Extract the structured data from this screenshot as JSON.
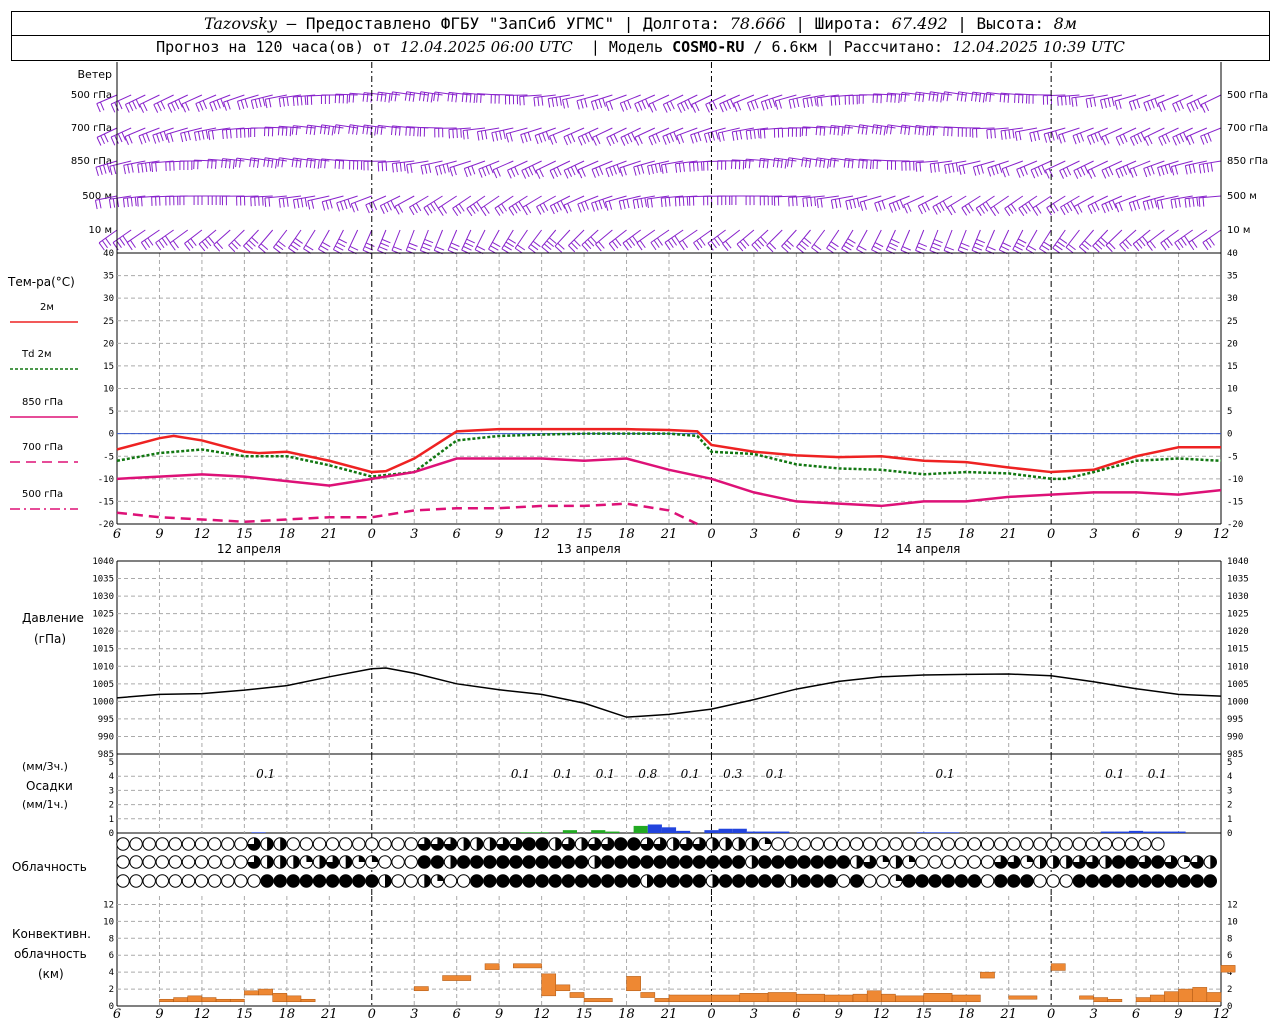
{
  "header": {
    "station": "Tazovsky",
    "provided": " — Предоставлено ФГБУ \"ЗапСиб УГМС\" | Долгота: ",
    "lon": "78.666",
    "lat_label": " | Широта: ",
    "lat": "67.492",
    "alt_label": " | Высота: ",
    "alt": "8м",
    "forecast_label": "Прогноз на 120 часа(ов) от ",
    "forecast_time": "12.04.2025 06:00 UTC",
    "model_label": "  | Модель ",
    "model": "COSMO-RU",
    "model_res": " / 6.6км",
    "calc_label": " | Рассчитано: ",
    "calc_time": "12.04.2025 10:39 UTC"
  },
  "panels": {
    "wind": {
      "title": "Ветер",
      "levels": [
        "500 гПа",
        "700 гПа",
        "850 гПа",
        "500 м",
        "10  м"
      ]
    },
    "temp": {
      "title": "Тем-ра(°С)",
      "legend": [
        {
          "label": "2м",
          "color": "#ee2222",
          "dash": ""
        },
        {
          "label": "Td  2м",
          "color": "#117711",
          "dash": "3,2"
        },
        {
          "label": "850 гПа",
          "color": "#dd1177",
          "dash": ""
        },
        {
          "label": "700 гПа",
          "color": "#dd1177",
          "dash": "10,6"
        },
        {
          "label": "500 гПа",
          "color": "#dd1177",
          "dash": "10,4,2,4"
        }
      ]
    },
    "pressure": {
      "title1": "Давление",
      "title2": "(гПа)"
    },
    "precip": {
      "title1": "(мм/3ч.)",
      "title2": "Осадки",
      "title3": "(мм/1ч.)"
    },
    "cloud": {
      "title": "Облачность"
    },
    "conv": {
      "title1": "Конвективн.",
      "title2": "облачность",
      "title3": "(км)"
    }
  },
  "time_axis": {
    "hour_labels": [
      "6",
      "9",
      "12",
      "15",
      "18",
      "21",
      "0",
      "3",
      "6",
      "9",
      "12",
      "15",
      "18",
      "21",
      "0",
      "3",
      "6",
      "9",
      "12",
      "15",
      "18",
      "21",
      "0",
      "3",
      "6",
      "9",
      "12"
    ],
    "day_labels": [
      {
        "label": "12 апреля",
        "at_hour": 6
      },
      {
        "label": "13 апреля",
        "at_hour": 30
      },
      {
        "label": "14 апреля",
        "at_hour": 54
      }
    ]
  },
  "chart_data": [
    {
      "type": "line",
      "title": "Тем-ра(°С)",
      "x_unit": "hours from 12.04 00 UTC",
      "ylim": [
        -20,
        40
      ],
      "yticks": [
        -20,
        -15,
        -10,
        -5,
        0,
        5,
        10,
        15,
        20,
        25,
        30,
        35,
        40
      ],
      "series": [
        {
          "name": "2м",
          "x": [
            6,
            9,
            10,
            12,
            15,
            16,
            18,
            21,
            24,
            25,
            27,
            30,
            33,
            36,
            39,
            42,
            45,
            47,
            48,
            51,
            54,
            57,
            60,
            63,
            66,
            69,
            72,
            75,
            78,
            81,
            84
          ],
          "values": [
            -3.5,
            -1,
            -0.5,
            -1.5,
            -4,
            -4.3,
            -4,
            -6,
            -8.5,
            -8.3,
            -5.5,
            0.5,
            1,
            1,
            1,
            1,
            0.8,
            0.5,
            -2.5,
            -4,
            -4.8,
            -5.2,
            -5,
            -6,
            -6.3,
            -7.5,
            -8.5,
            -8,
            -5,
            -3,
            -3
          ]
        },
        {
          "name": "Td  2м",
          "x": [
            6,
            9,
            12,
            15,
            18,
            21,
            24,
            27,
            30,
            33,
            36,
            39,
            42,
            45,
            47,
            48,
            51,
            54,
            57,
            60,
            63,
            66,
            69,
            72,
            73,
            75,
            78,
            81,
            84
          ],
          "values": [
            -6,
            -4.3,
            -3.5,
            -5,
            -5,
            -7,
            -9.5,
            -8.5,
            -1.5,
            -0.5,
            -0.2,
            0,
            0,
            0,
            -0.5,
            -4,
            -4.5,
            -6.8,
            -7.7,
            -8,
            -9,
            -8.5,
            -8.8,
            -10,
            -10,
            -8.5,
            -6,
            -5.5,
            -6
          ]
        },
        {
          "name": "850 гПа",
          "x": [
            6,
            9,
            12,
            15,
            18,
            21,
            24,
            27,
            30,
            33,
            36,
            39,
            42,
            45,
            48,
            51,
            54,
            57,
            60,
            63,
            66,
            69,
            72,
            75,
            78,
            81,
            84
          ],
          "values": [
            -10,
            -9.5,
            -9,
            -9.5,
            -10.5,
            -11.5,
            -10,
            -8.5,
            -5.5,
            -5.5,
            -5.5,
            -6,
            -5.5,
            -8,
            -10,
            -13,
            -15,
            -15.5,
            -16,
            -15,
            -15,
            -14,
            -13.5,
            -13,
            -13,
            -13.5,
            -12.5
          ]
        },
        {
          "name": "700 гПа",
          "x": [
            6,
            9,
            12,
            15,
            18,
            21,
            24,
            27,
            30,
            33,
            36,
            39,
            42,
            45,
            47
          ],
          "values": [
            -17.5,
            -18.5,
            -19,
            -19.5,
            -19,
            -18.5,
            -18.5,
            -17,
            -16.5,
            -16.5,
            -16,
            -16,
            -15.5,
            -17,
            -20
          ]
        },
        {
          "name": "500 гПа",
          "x": [],
          "values": []
        }
      ]
    },
    {
      "type": "line",
      "title": "Давление",
      "ylim": [
        985,
        1040
      ],
      "yticks": [
        985,
        990,
        995,
        1000,
        1005,
        1010,
        1015,
        1020,
        1025,
        1030,
        1035,
        1040
      ],
      "series": [
        {
          "name": "Давление",
          "x": [
            6,
            9,
            12,
            15,
            18,
            21,
            24,
            25,
            27,
            30,
            33,
            36,
            39,
            42,
            45,
            48,
            51,
            54,
            57,
            60,
            63,
            66,
            69,
            72,
            75,
            78,
            81,
            84
          ],
          "values": [
            1001,
            1002,
            1002.2,
            1003.2,
            1004.5,
            1007,
            1009.3,
            1009.5,
            1008,
            1005,
            1003.3,
            1002,
            999.5,
            995.5,
            996.3,
            997.8,
            1000.5,
            1003.5,
            1005.7,
            1007,
            1007.5,
            1007.7,
            1007.8,
            1007.3,
            1005.6,
            1003.6,
            1002,
            1001.5
          ]
        }
      ]
    },
    {
      "type": "bar",
      "title": "Осадки",
      "ylim": [
        0,
        5
      ],
      "yticks": [
        0,
        1,
        2,
        3,
        4,
        5
      ],
      "labels_3h": [
        {
          "x": 16.5,
          "text": "0.1"
        },
        {
          "x": 34.5,
          "text": "0.1"
        },
        {
          "x": 37.5,
          "text": "0.1"
        },
        {
          "x": 40.5,
          "text": "0.1"
        },
        {
          "x": 43.5,
          "text": "0.8"
        },
        {
          "x": 46.5,
          "text": "0.1"
        },
        {
          "x": 49.5,
          "text": "0.3"
        },
        {
          "x": 52.5,
          "text": "0.1"
        },
        {
          "x": 64.5,
          "text": "0.1"
        },
        {
          "x": 76.5,
          "text": "0.1"
        },
        {
          "x": 79.5,
          "text": "0.1"
        }
      ],
      "bars_1h": [
        {
          "x": 16,
          "value": 0.05,
          "color": "#2244dd"
        },
        {
          "x": 35,
          "value": 0.05,
          "color": "#22aa22"
        },
        {
          "x": 36,
          "value": 0.05,
          "color": "#22aa22"
        },
        {
          "x": 38,
          "value": 0.2,
          "color": "#22aa22"
        },
        {
          "x": 40,
          "value": 0.2,
          "color": "#22aa22"
        },
        {
          "x": 41,
          "value": 0.1,
          "color": "#22aa22"
        },
        {
          "x": 43,
          "value": 0.5,
          "color": "#22aa22"
        },
        {
          "x": 44,
          "value": 0.6,
          "color": "#2244dd"
        },
        {
          "x": 45,
          "value": 0.4,
          "color": "#2244dd"
        },
        {
          "x": 46,
          "value": 0.15,
          "color": "#2244dd"
        },
        {
          "x": 48,
          "value": 0.2,
          "color": "#2244dd"
        },
        {
          "x": 49,
          "value": 0.3,
          "color": "#2244dd"
        },
        {
          "x": 50,
          "value": 0.3,
          "color": "#2244dd"
        },
        {
          "x": 51,
          "value": 0.1,
          "color": "#2244dd"
        },
        {
          "x": 52,
          "value": 0.1,
          "color": "#2244dd"
        },
        {
          "x": 53,
          "value": 0.1,
          "color": "#2244dd"
        },
        {
          "x": 63,
          "value": 0.05,
          "color": "#2244dd"
        },
        {
          "x": 64,
          "value": 0.05,
          "color": "#2244dd"
        },
        {
          "x": 65,
          "value": 0.05,
          "color": "#2244dd"
        },
        {
          "x": 76,
          "value": 0.1,
          "color": "#2244dd"
        },
        {
          "x": 77,
          "value": 0.1,
          "color": "#2244dd"
        },
        {
          "x": 78,
          "value": 0.15,
          "color": "#2244dd"
        },
        {
          "x": 79,
          "value": 0.1,
          "color": "#2244dd"
        },
        {
          "x": 80,
          "value": 0.1,
          "color": "#2244dd"
        },
        {
          "x": 81,
          "value": 0.1,
          "color": "#2244dd"
        }
      ]
    },
    {
      "type": "table",
      "title": "Облачность",
      "note": "cloud fraction per hour (0-4 quarters), rows: upper, middle, lower",
      "upper": [
        0,
        0,
        0,
        0,
        0,
        0,
        0,
        0,
        0,
        0,
        3,
        2,
        2,
        0,
        0,
        0,
        0,
        0,
        0,
        0,
        0,
        0,
        0,
        3,
        3,
        3,
        2,
        2,
        2,
        3,
        3,
        4,
        4,
        2,
        3,
        2,
        3,
        3,
        4,
        4,
        3,
        3,
        2,
        3,
        3,
        2,
        2,
        2,
        2,
        1,
        0,
        0,
        0,
        0,
        0,
        0,
        0,
        0,
        0,
        0,
        0,
        0,
        0,
        0,
        0,
        0,
        0,
        0,
        0,
        0,
        0,
        0,
        0,
        0,
        0,
        0,
        0,
        0,
        0,
        0
      ],
      "middle": [
        0,
        0,
        0,
        0,
        0,
        0,
        0,
        0,
        0,
        0,
        3,
        2,
        2,
        2,
        1,
        2,
        3,
        2,
        1,
        1,
        0,
        0,
        0,
        4,
        4,
        2,
        4,
        4,
        4,
        4,
        4,
        4,
        4,
        4,
        4,
        4,
        2,
        4,
        4,
        4,
        4,
        4,
        4,
        4,
        4,
        4,
        4,
        4,
        2,
        4,
        4,
        4,
        4,
        4,
        4,
        4,
        2,
        3,
        1,
        2,
        1,
        0,
        0,
        0,
        0,
        0,
        0,
        3,
        3,
        1,
        2,
        2,
        2,
        3,
        3,
        2,
        4,
        4,
        3,
        4,
        3,
        1,
        3,
        2,
        0,
        0
      ],
      "lower": [
        0,
        0,
        0,
        0,
        0,
        0,
        0,
        0,
        0,
        0,
        0,
        4,
        4,
        4,
        4,
        4,
        4,
        4,
        4,
        4,
        2,
        0,
        0,
        2,
        1,
        0,
        0,
        4,
        4,
        4,
        4,
        4,
        4,
        4,
        4,
        4,
        4,
        4,
        4,
        4,
        2,
        4,
        4,
        4,
        4,
        2,
        4,
        4,
        4,
        4,
        4,
        2,
        4,
        4,
        4,
        0,
        4,
        0,
        0,
        1,
        4,
        4,
        4,
        4,
        4,
        4,
        0,
        4,
        4,
        4,
        0,
        0,
        0,
        4,
        4,
        4,
        4,
        4,
        4,
        4,
        4,
        4,
        4,
        4,
        4,
        4
      ]
    },
    {
      "type": "bar",
      "title": "Конвективн. облачность",
      "ylim": [
        0,
        13
      ],
      "yticks": [
        0,
        2,
        4,
        6,
        8,
        10,
        12
      ],
      "segments": [
        {
          "x0": 9,
          "x1": 10,
          "y0": 0.5,
          "y1": 0.8
        },
        {
          "x0": 10,
          "x1": 11,
          "y0": 0.5,
          "y1": 1.0
        },
        {
          "x0": 11,
          "x1": 12,
          "y0": 0.5,
          "y1": 1.2
        },
        {
          "x0": 12,
          "x1": 13,
          "y0": 0.5,
          "y1": 1.0
        },
        {
          "x0": 13,
          "x1": 14,
          "y0": 0.5,
          "y1": 0.8
        },
        {
          "x0": 14,
          "x1": 15,
          "y0": 0.5,
          "y1": 0.8
        },
        {
          "x0": 15,
          "x1": 16,
          "y0": 1.3,
          "y1": 1.8
        },
        {
          "x0": 16,
          "x1": 17,
          "y0": 1.3,
          "y1": 2.0
        },
        {
          "x0": 17,
          "x1": 18,
          "y0": 0.5,
          "y1": 1.5
        },
        {
          "x0": 18,
          "x1": 19,
          "y0": 0.5,
          "y1": 1.2
        },
        {
          "x0": 19,
          "x1": 20,
          "y0": 0.5,
          "y1": 0.8
        },
        {
          "x0": 27,
          "x1": 28,
          "y0": 1.8,
          "y1": 2.3
        },
        {
          "x0": 29,
          "x1": 31,
          "y0": 3.0,
          "y1": 3.6
        },
        {
          "x0": 32,
          "x1": 33,
          "y0": 4.3,
          "y1": 5.0
        },
        {
          "x0": 34,
          "x1": 36,
          "y0": 4.5,
          "y1": 5.0
        },
        {
          "x0": 36,
          "x1": 37,
          "y0": 1.2,
          "y1": 3.8
        },
        {
          "x0": 37,
          "x1": 38,
          "y0": 1.8,
          "y1": 2.5
        },
        {
          "x0": 38,
          "x1": 39,
          "y0": 1.0,
          "y1": 1.6
        },
        {
          "x0": 39,
          "x1": 41,
          "y0": 0.5,
          "y1": 0.9
        },
        {
          "x0": 42,
          "x1": 43,
          "y0": 1.8,
          "y1": 3.5
        },
        {
          "x0": 43,
          "x1": 44,
          "y0": 1.0,
          "y1": 1.6
        },
        {
          "x0": 44,
          "x1": 45,
          "y0": 0.5,
          "y1": 0.9
        },
        {
          "x0": 45,
          "x1": 48,
          "y0": 0.5,
          "y1": 1.3
        },
        {
          "x0": 48,
          "x1": 50,
          "y0": 0.5,
          "y1": 1.3
        },
        {
          "x0": 50,
          "x1": 52,
          "y0": 0.5,
          "y1": 1.5
        },
        {
          "x0": 52,
          "x1": 54,
          "y0": 0.5,
          "y1": 1.6
        },
        {
          "x0": 54,
          "x1": 56,
          "y0": 0.5,
          "y1": 1.4
        },
        {
          "x0": 56,
          "x1": 58,
          "y0": 0.5,
          "y1": 1.3
        },
        {
          "x0": 58,
          "x1": 59,
          "y0": 0.5,
          "y1": 1.4
        },
        {
          "x0": 59,
          "x1": 60,
          "y0": 0.5,
          "y1": 1.8
        },
        {
          "x0": 60,
          "x1": 61,
          "y0": 0.5,
          "y1": 1.4
        },
        {
          "x0": 61,
          "x1": 63,
          "y0": 0.5,
          "y1": 1.2
        },
        {
          "x0": 63,
          "x1": 65,
          "y0": 0.5,
          "y1": 1.5
        },
        {
          "x0": 65,
          "x1": 67,
          "y0": 0.5,
          "y1": 1.3
        },
        {
          "x0": 67,
          "x1": 68,
          "y0": 3.3,
          "y1": 4.0
        },
        {
          "x0": 69,
          "x1": 71,
          "y0": 0.8,
          "y1": 1.2
        },
        {
          "x0": 72,
          "x1": 73,
          "y0": 4.2,
          "y1": 5.0
        },
        {
          "x0": 74,
          "x1": 75,
          "y0": 0.8,
          "y1": 1.2
        },
        {
          "x0": 75,
          "x1": 76,
          "y0": 0.5,
          "y1": 1.0
        },
        {
          "x0": 76,
          "x1": 77,
          "y0": 0.5,
          "y1": 0.8
        },
        {
          "x0": 78,
          "x1": 79,
          "y0": 0.5,
          "y1": 1.0
        },
        {
          "x0": 79,
          "x1": 80,
          "y0": 0.5,
          "y1": 1.3
        },
        {
          "x0": 80,
          "x1": 81,
          "y0": 0.5,
          "y1": 1.7
        },
        {
          "x0": 81,
          "x1": 82,
          "y0": 0.5,
          "y1": 2.0
        },
        {
          "x0": 82,
          "x1": 83,
          "y0": 0.5,
          "y1": 2.2
        },
        {
          "x0": 83,
          "x1": 84,
          "y0": 0.5,
          "y1": 1.6
        },
        {
          "x0": 84,
          "x1": 85,
          "y0": 4.0,
          "y1": 4.8
        }
      ],
      "color": "#ee8833"
    }
  ]
}
